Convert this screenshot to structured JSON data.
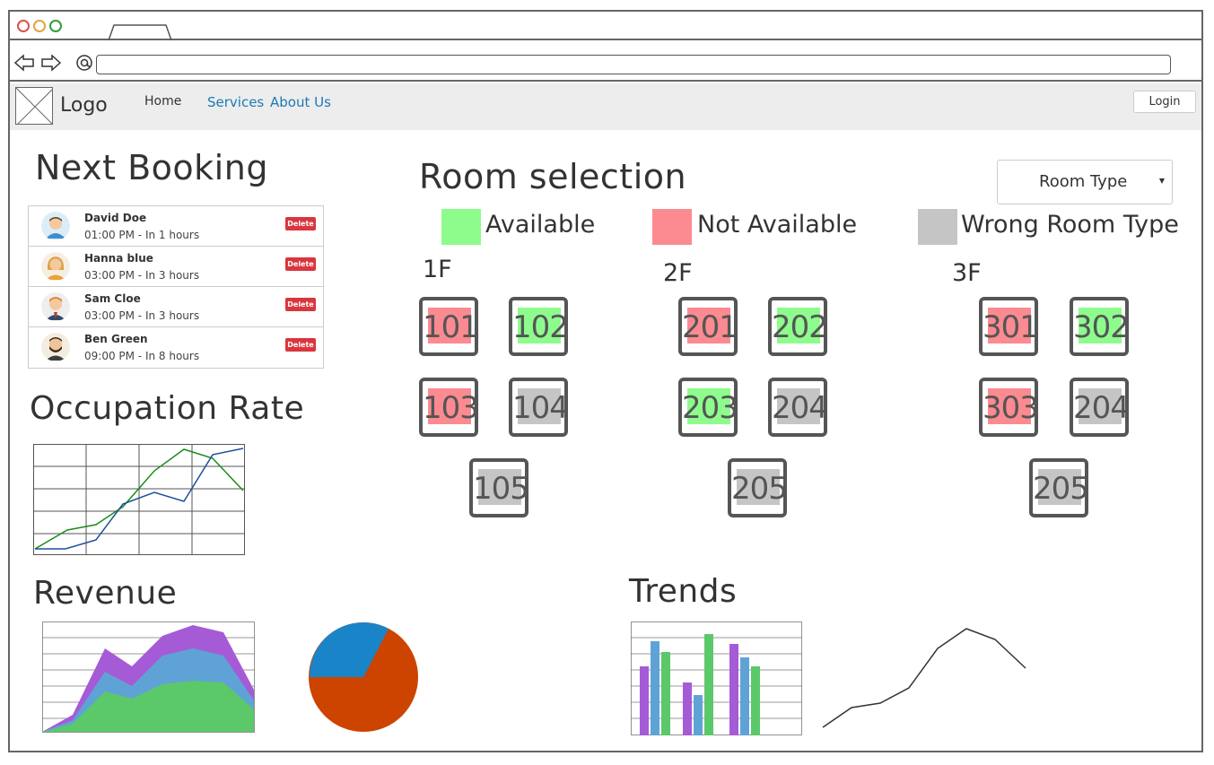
{
  "browser": {
    "url": "",
    "nav": {
      "back_icon": "back-arrow-icon",
      "forward_icon": "forward-arrow-icon",
      "home_icon": "at-sign-icon"
    }
  },
  "header": {
    "logo_text": "Logo",
    "nav": [
      {
        "label": "Home"
      },
      {
        "label": "Services"
      },
      {
        "label": "About Us"
      }
    ],
    "login_label": "Login"
  },
  "next_booking": {
    "title": "Next Booking",
    "items": [
      {
        "name": "David Doe",
        "time": "01:00 PM - In 1 hours",
        "delete_label": "Delete"
      },
      {
        "name": "Hanna blue",
        "time": "03:00 PM - In 3 hours",
        "delete_label": "Delete"
      },
      {
        "name": "Sam Cloe",
        "time": "03:00 PM - In 3 hours",
        "delete_label": "Delete"
      },
      {
        "name": "Ben Green",
        "time": "09:00 PM - In 8 hours",
        "delete_label": "Delete"
      }
    ]
  },
  "occupation": {
    "title": "Occupation Rate"
  },
  "room_selection": {
    "title": "Room selection",
    "room_type_select": {
      "value": "Room Type"
    },
    "legend": [
      {
        "label": "Available",
        "color": "#8dfc8d"
      },
      {
        "label": "Not Available",
        "color": "#fc8a91"
      },
      {
        "label": "Wrong Room Type",
        "color": "#c5c5c5"
      }
    ],
    "floors": [
      {
        "label": "1F",
        "rooms": [
          {
            "number": "101",
            "status": "not-available"
          },
          {
            "number": "102",
            "status": "available"
          },
          {
            "number": "103",
            "status": "not-available"
          },
          {
            "number": "104",
            "status": "wrong-type"
          },
          {
            "number": "105",
            "status": "wrong-type"
          }
        ]
      },
      {
        "label": "2F",
        "rooms": [
          {
            "number": "201",
            "status": "not-available"
          },
          {
            "number": "202",
            "status": "available"
          },
          {
            "number": "203",
            "status": "available"
          },
          {
            "number": "204",
            "status": "wrong-type"
          },
          {
            "number": "205",
            "status": "wrong-type"
          }
        ]
      },
      {
        "label": "3F",
        "rooms": [
          {
            "number": "301",
            "status": "not-available"
          },
          {
            "number": "302",
            "status": "available"
          },
          {
            "number": "303",
            "status": "not-available"
          },
          {
            "number": "204",
            "status": "wrong-type"
          },
          {
            "number": "205",
            "status": "wrong-type"
          }
        ]
      }
    ]
  },
  "revenue": {
    "title": "Revenue"
  },
  "trends": {
    "title": "Trends"
  },
  "colors": {
    "available": "#8dfc8d",
    "not_available": "#fc8a91",
    "wrong_type": "#c5c5c5",
    "link": "#1a7ab5",
    "delete": "#d9363e"
  }
}
